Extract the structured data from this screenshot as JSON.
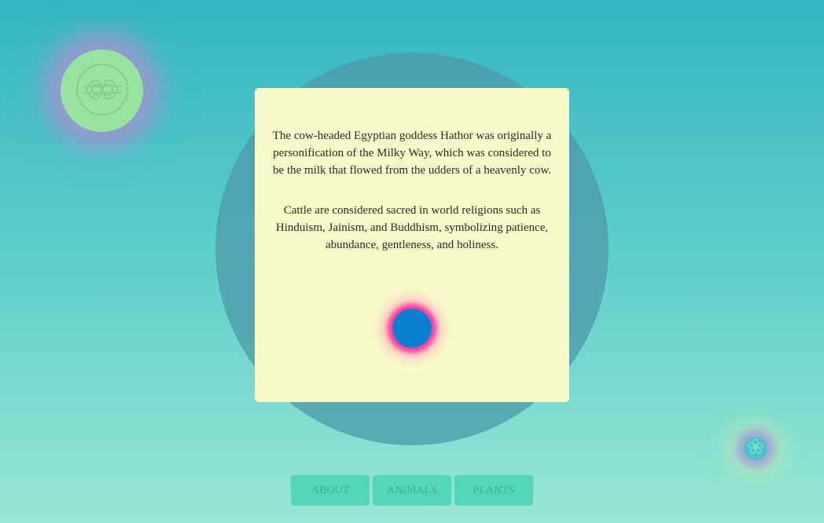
{
  "card": {
    "paragraphs": [
      "The cow-headed Egyptian goddess Hathor was originally a personification of the Milky Way, which was considered to be the milk that flowed from the udders of a heavenly cow.",
      "Cattle are considered sacred in world religions such as Hinduism, Jainism, and Buddhism, symbolizing patience, abundance, gentleness, and holiness."
    ]
  },
  "nav": {
    "items": [
      {
        "label": "ABOUT"
      },
      {
        "label": "ANIMALS"
      },
      {
        "label": "PLANTS"
      }
    ]
  },
  "icons": {
    "top_left": "endless-knot-icon",
    "bottom_right": "flower-icon"
  },
  "colors": {
    "background_top": "#34b6c2",
    "background_bottom": "#99e6d4",
    "card": "#f8facb",
    "dot": "#0a7fd0",
    "dot_glow": "#ff3ea0",
    "nav_button": "#55d6b8"
  }
}
